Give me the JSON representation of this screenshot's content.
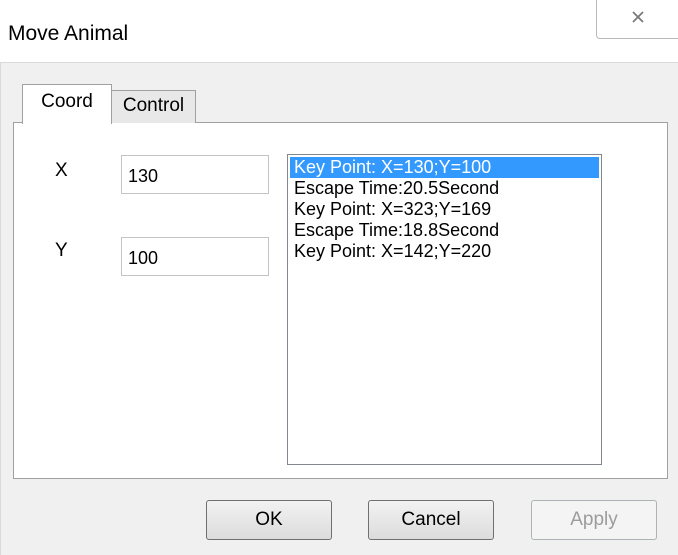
{
  "window": {
    "title": "Move Animal",
    "close_icon": "close-icon"
  },
  "tabs": [
    {
      "label": "Coord",
      "selected": true
    },
    {
      "label": "Control",
      "selected": false
    }
  ],
  "fields": {
    "x": {
      "label": "X",
      "value": "130"
    },
    "y": {
      "label": "Y",
      "value": "100"
    }
  },
  "list": {
    "items": [
      "Key Point: X=130;Y=100",
      "Escape Time:20.5Second",
      "Key Point: X=323;Y=169",
      "Escape Time:18.8Second",
      "Key Point: X=142;Y=220"
    ],
    "selected_index": 0,
    "selected_color": "#3399ff"
  },
  "buttons": {
    "ok": "OK",
    "cancel": "Cancel",
    "apply": "Apply"
  }
}
